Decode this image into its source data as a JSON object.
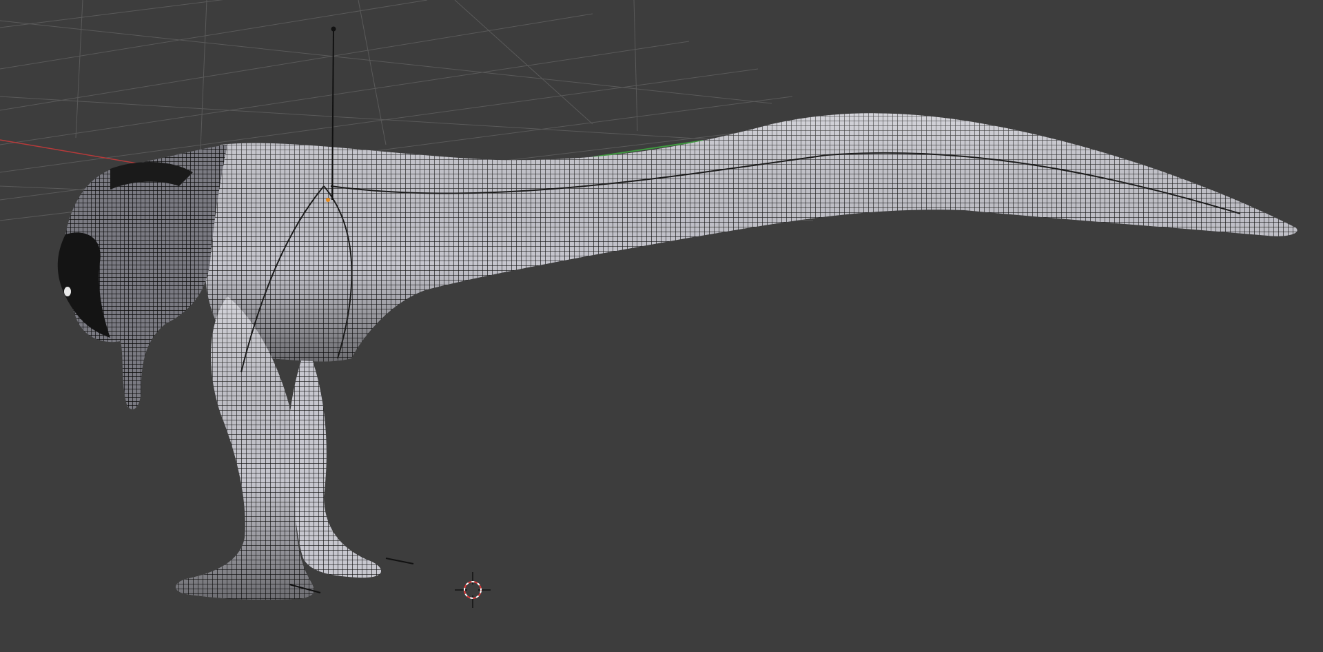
{
  "viewport": {
    "mode": "3d-viewport",
    "shading": "wireframe",
    "background_color": "#3d3d3d",
    "grid_color": "#5a5a5a",
    "x_axis_color": "#b83a3a",
    "y_axis_color": "#3f9a3f",
    "mesh_fill_color": "#c4c4cc",
    "mesh_wire_color": "#111111",
    "object": {
      "icon": "dinosaur-mesh-icon",
      "selected": true
    },
    "cursor": {
      "icon": "3d-cursor-icon",
      "ring_color": "#e03a3a"
    },
    "armature": {
      "icon": "armature-bone-icon"
    }
  }
}
